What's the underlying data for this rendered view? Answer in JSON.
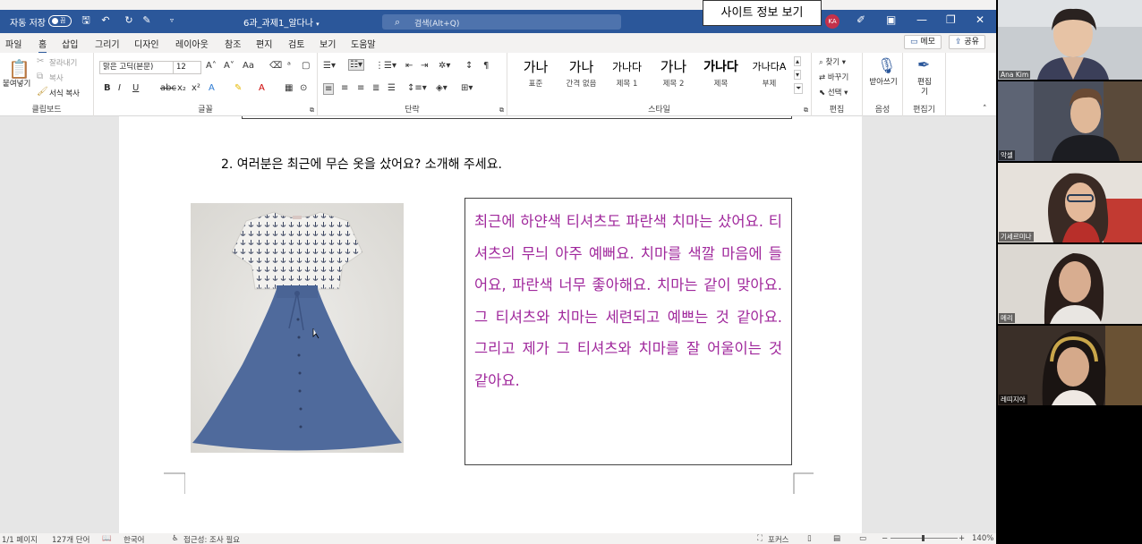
{
  "titlebar": {
    "autosave_label": "자동 저장",
    "autosave_state": "끔",
    "doc_name": "6과_과제1_알다나",
    "search_placeholder": "검색(Alt+Q)",
    "site_info_button": "사이트 정보 보기",
    "user_initials": "KA"
  },
  "menu": {
    "tabs": [
      "파일",
      "홈",
      "삽입",
      "그리기",
      "디자인",
      "레이아웃",
      "참조",
      "편지",
      "검토",
      "보기",
      "도움말"
    ],
    "active_tab": "홈",
    "memo_button": "메모",
    "share_button": "공유"
  },
  "ribbon": {
    "clipboard": {
      "paste": "붙여넣기",
      "cut": "잘라내기",
      "copy": "복사",
      "format_painter": "서식 복사",
      "group_label": "클립보드"
    },
    "font": {
      "font_name": "맑은 고딕(본문)",
      "font_size": "12",
      "group_label": "글꼴"
    },
    "paragraph": {
      "group_label": "단락"
    },
    "styles": {
      "tiles": [
        {
          "sample": "가나",
          "name": "표준"
        },
        {
          "sample": "가나",
          "name": "간격 없음"
        },
        {
          "sample": "가나다",
          "name": "제목 1"
        },
        {
          "sample": "가나",
          "name": "제목 2"
        },
        {
          "sample": "가나다",
          "name": "제목"
        },
        {
          "sample": "가나다A",
          "name": "부제"
        }
      ],
      "group_label": "스타일"
    },
    "editing": {
      "find": "찾기",
      "replace": "바꾸기",
      "select": "선택",
      "group_label": "편집"
    },
    "voice": {
      "dictate": "받아쓰기",
      "group_label": "음성"
    },
    "editor": {
      "label": "편집기",
      "group_label": "편집기"
    }
  },
  "document": {
    "question": "2.  여러분은 최근에 무슨 옷을 샀어요? 소개해 주세요.",
    "answer": "최근에 하얀색 티셔츠도 파란색 치마는 샀어요. 티셔츠의 무늬 아주 예뻐요. 치마를 색깔 마음에 들어요, 파란색 너무 좋아해요. 치마는 같이 맞아요. 그 티셔츠와 치마는 세련되고 예쁘는 것 같아요. 그리고 제가 그 티셔츠와 치마를 잘 어울이는 것 같아요."
  },
  "status": {
    "page": "1/1 페이지",
    "words": "127개 단어",
    "language": "한국어",
    "accessibility": "접근성: 조사 필요",
    "focus": "포커스",
    "zoom": "140%"
  },
  "participants": [
    {
      "name": "Ana Kim"
    },
    {
      "name": "악셀"
    },
    {
      "name": "기세르미나"
    },
    {
      "name": "메리"
    },
    {
      "name": "레띠지아"
    }
  ],
  "colors": {
    "title_bar": "#2b579a",
    "answer_text": "#a0289c",
    "skirt": "#4f6a9c"
  }
}
